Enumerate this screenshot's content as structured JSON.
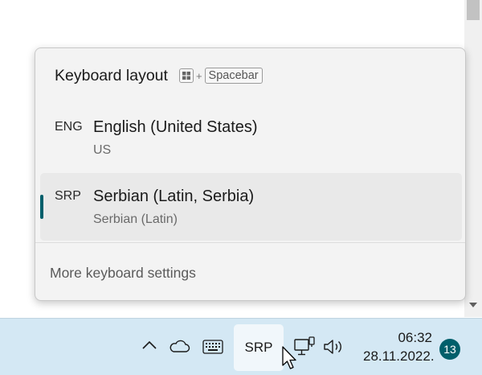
{
  "flyout": {
    "title": "Keyboard layout",
    "shortcut": {
      "plus": "+",
      "key": "Spacebar"
    },
    "layouts": [
      {
        "code": "ENG",
        "name": "English (United States)",
        "sub": "US",
        "selected": false
      },
      {
        "code": "SRP",
        "name": "Serbian (Latin, Serbia)",
        "sub": "Serbian (Latin)",
        "selected": true
      }
    ],
    "more_settings": "More keyboard settings"
  },
  "taskbar": {
    "language": "SRP",
    "time": "06:32",
    "date": "28.11.2022.",
    "notification_count": "13",
    "icons": [
      "chevron-up-icon",
      "cloud-icon",
      "keyboard-icon",
      "network-icon",
      "volume-icon"
    ]
  },
  "colors": {
    "accent": "#005f6b",
    "taskbar": "#d4e8f4",
    "flyout": "#f3f3f3"
  }
}
